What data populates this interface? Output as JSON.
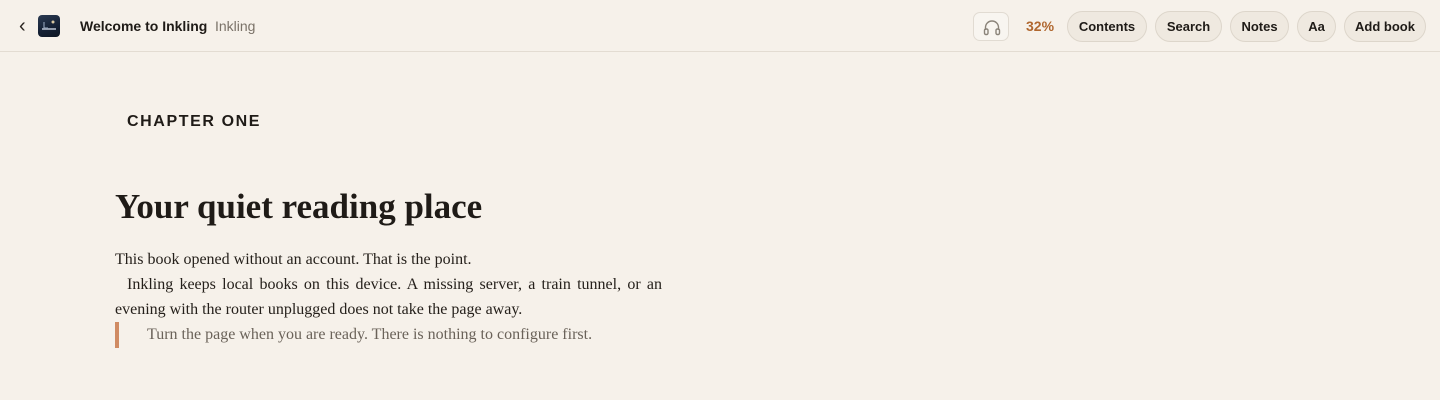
{
  "topbar": {
    "back_icon": "chevron-left-icon",
    "cover_icon": "book-cover-icon",
    "book_title": "Welcome to Inkling",
    "book_author": "Inkling",
    "audio_icon": "headphones-icon",
    "progress_label": "32%",
    "progress_value": 0.32,
    "buttons": {
      "contents": "Contents",
      "search": "Search",
      "notes": "Notes",
      "font": "Aa",
      "add_book": "Add book"
    }
  },
  "reader": {
    "chapter_label": "CHAPTER ONE",
    "heading": "Your quiet reading place",
    "paragraph_1": "This book opened without an account. That is the point.",
    "paragraph_2": "Inkling keeps local books on this device. A missing server, a train tunnel, or an evening with the router unplugged does not take the page away.",
    "quote": "Turn the page when you are ready. There is nothing to configure first."
  },
  "colors": {
    "background": "#f6f1ea",
    "accent": "#b0672f",
    "quote_bar": "#d08b63"
  }
}
